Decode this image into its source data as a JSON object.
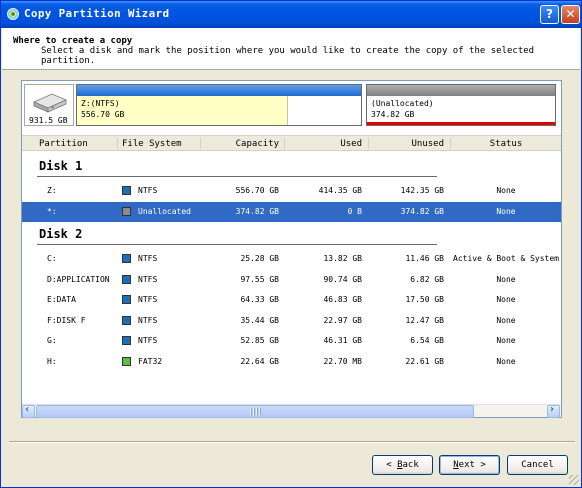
{
  "window": {
    "title": "Copy Partition Wizard",
    "help_glyph": "?",
    "close_glyph": "✕"
  },
  "header": {
    "title": "Where to create a copy",
    "subtitle": "Select a disk and mark the position where you would like to create the copy of the selected partition."
  },
  "disk_map": {
    "disk_size": "931.5 GB",
    "partitions": [
      {
        "label": "Z:(NTFS)",
        "size": "556.70 GB",
        "used_fraction": 0.744
      },
      {
        "label": "(Unallocated)",
        "size": "374.82 GB"
      }
    ]
  },
  "table": {
    "columns": [
      "Partition",
      "File System",
      "Capacity",
      "Used",
      "Unused",
      "Status"
    ],
    "groups": [
      {
        "name": "Disk 1",
        "rows": [
          {
            "partition": "Z:",
            "fs": "NTFS",
            "fs_color": "#1E6EB5",
            "capacity": "556.70 GB",
            "used": "414.35 GB",
            "unused": "142.35 GB",
            "status": "None",
            "selected": false
          },
          {
            "partition": "*:",
            "fs": "Unallocated",
            "fs_color": "#8C8C8C",
            "capacity": "374.82 GB",
            "used": "0 B",
            "unused": "374.82 GB",
            "status": "None",
            "selected": true
          }
        ]
      },
      {
        "name": "Disk 2",
        "rows": [
          {
            "partition": "C:",
            "fs": "NTFS",
            "fs_color": "#1E6EB5",
            "capacity": "25.28 GB",
            "used": "13.82 GB",
            "unused": "11.46 GB",
            "status": "Active & Boot & System",
            "selected": false
          },
          {
            "partition": "D:APPLICATION",
            "fs": "NTFS",
            "fs_color": "#1E6EB5",
            "capacity": "97.55 GB",
            "used": "90.74 GB",
            "unused": "6.82 GB",
            "status": "None",
            "selected": false
          },
          {
            "partition": "E:DATA",
            "fs": "NTFS",
            "fs_color": "#1E6EB5",
            "capacity": "64.33 GB",
            "used": "46.83 GB",
            "unused": "17.50 GB",
            "status": "None",
            "selected": false
          },
          {
            "partition": "F:DISK F",
            "fs": "NTFS",
            "fs_color": "#1E6EB5",
            "capacity": "35.44 GB",
            "used": "22.97 GB",
            "unused": "12.47 GB",
            "status": "None",
            "selected": false
          },
          {
            "partition": "G:",
            "fs": "NTFS",
            "fs_color": "#1E6EB5",
            "capacity": "52.85 GB",
            "used": "46.31 GB",
            "unused": "6.54 GB",
            "status": "None",
            "selected": false
          },
          {
            "partition": "H:",
            "fs": "FAT32",
            "fs_color": "#5DBB4A",
            "capacity": "22.64 GB",
            "used": "22.70 MB",
            "unused": "22.61 GB",
            "status": "None",
            "selected": false
          }
        ]
      }
    ]
  },
  "buttons": {
    "back": {
      "accel": "B",
      "rest": "ack",
      "prefix": "< ",
      "suffix": ""
    },
    "next": {
      "accel": "N",
      "rest": "ext",
      "prefix": "",
      "suffix": " >"
    },
    "cancel": "Cancel"
  },
  "colors": {
    "selection": "#316AC5",
    "unallocated_marker": "#E00000"
  }
}
